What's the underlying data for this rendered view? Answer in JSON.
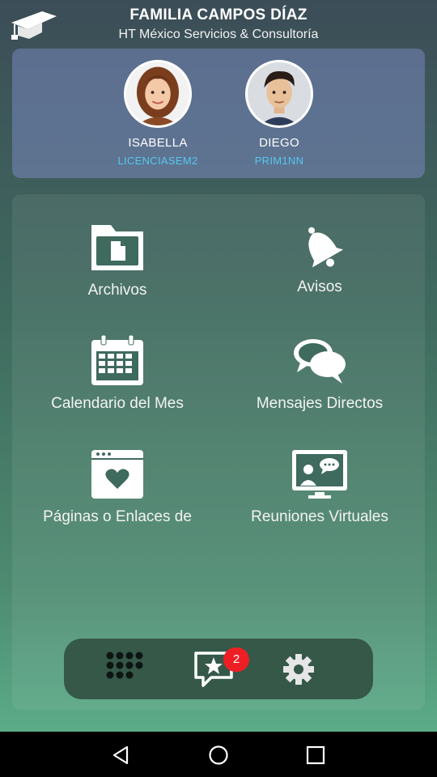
{
  "header": {
    "family_name": "FAMILIA CAMPOS DÍAZ",
    "organization": "HT México Servicios & Consultoría",
    "logo_icon": "graduation-cap-icon"
  },
  "students": [
    {
      "name": "ISABELLA",
      "group": "LICENCIASEM2"
    },
    {
      "name": "DIEGO",
      "group": "PRIM1NN"
    }
  ],
  "colors": {
    "group_text": "#55c8ee",
    "badge": "#ee1f24",
    "bottom_bar": "#355848"
  },
  "menu": [
    {
      "label": "Archivos",
      "icon": "folder-document-icon"
    },
    {
      "label": "Avisos",
      "icon": "bell-icon"
    },
    {
      "label": "Calendario del Mes",
      "icon": "calendar-icon"
    },
    {
      "label": "Mensajes Directos",
      "icon": "chat-bubbles-icon"
    },
    {
      "label": "Páginas o Enlaces de",
      "icon": "web-page-heart-icon"
    },
    {
      "label": "Reuniones Virtuales",
      "icon": "video-meeting-icon"
    }
  ],
  "bottom_bar": {
    "items": [
      {
        "icon": "grid-dots-icon"
      },
      {
        "icon": "star-message-icon",
        "badge": "2"
      },
      {
        "icon": "gear-icon"
      }
    ]
  },
  "system_nav": [
    "back-icon",
    "home-icon",
    "recents-icon"
  ]
}
